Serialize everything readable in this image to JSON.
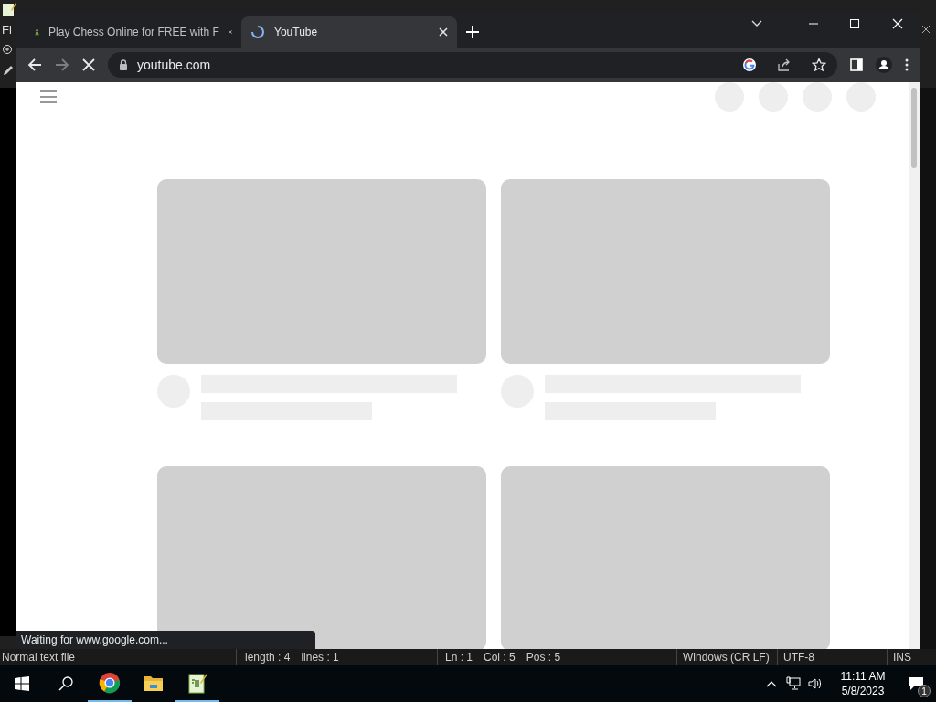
{
  "background_app": {
    "menu_fragment": "Fi"
  },
  "browser": {
    "tabs": [
      {
        "title": "Play Chess Online for FREE with F",
        "kind": "pawn",
        "selected": false
      },
      {
        "title": "YouTube",
        "kind": "loading",
        "selected": true
      }
    ],
    "address": "youtube.com",
    "loading": true,
    "status_bubble": "Waiting for www.google.com..."
  },
  "editor_status_bar": {
    "file_type": "Normal text file",
    "length": "length : 4",
    "lines": "lines : 1",
    "ln": "Ln : 1",
    "col": "Col : 5",
    "pos": "Pos : 5",
    "eol": "Windows (CR LF)",
    "encoding": "UTF-8",
    "mode": "INS"
  },
  "taskbar": {
    "apps": [
      {
        "kind": "chrome",
        "active": true
      },
      {
        "kind": "explorer",
        "active": false
      },
      {
        "kind": "notepad",
        "active": true
      }
    ],
    "time": "11:11 AM",
    "date": "5/8/2023",
    "notifications": "1"
  }
}
